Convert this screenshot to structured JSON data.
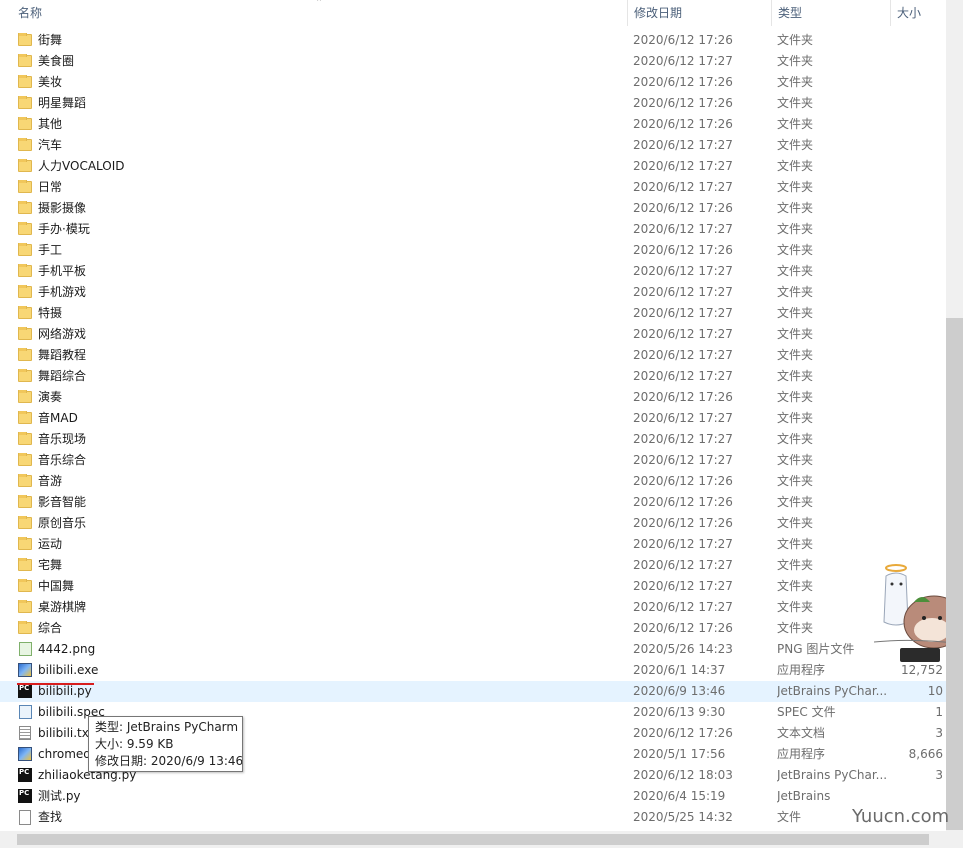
{
  "columns": {
    "name": "名称",
    "date": "修改日期",
    "type": "类型",
    "size": "大小"
  },
  "rows": [
    {
      "name": "街舞",
      "date": "2020/6/12 17:26",
      "type": "文件夹",
      "size": "",
      "icon": "folder"
    },
    {
      "name": "美食圈",
      "date": "2020/6/12 17:27",
      "type": "文件夹",
      "size": "",
      "icon": "folder"
    },
    {
      "name": "美妆",
      "date": "2020/6/12 17:26",
      "type": "文件夹",
      "size": "",
      "icon": "folder"
    },
    {
      "name": "明星舞蹈",
      "date": "2020/6/12 17:26",
      "type": "文件夹",
      "size": "",
      "icon": "folder"
    },
    {
      "name": "其他",
      "date": "2020/6/12 17:26",
      "type": "文件夹",
      "size": "",
      "icon": "folder"
    },
    {
      "name": "汽车",
      "date": "2020/6/12 17:27",
      "type": "文件夹",
      "size": "",
      "icon": "folder"
    },
    {
      "name": "人力VOCALOID",
      "date": "2020/6/12 17:27",
      "type": "文件夹",
      "size": "",
      "icon": "folder"
    },
    {
      "name": "日常",
      "date": "2020/6/12 17:27",
      "type": "文件夹",
      "size": "",
      "icon": "folder"
    },
    {
      "name": "摄影摄像",
      "date": "2020/6/12 17:26",
      "type": "文件夹",
      "size": "",
      "icon": "folder"
    },
    {
      "name": "手办·模玩",
      "date": "2020/6/12 17:27",
      "type": "文件夹",
      "size": "",
      "icon": "folder"
    },
    {
      "name": "手工",
      "date": "2020/6/12 17:26",
      "type": "文件夹",
      "size": "",
      "icon": "folder"
    },
    {
      "name": "手机平板",
      "date": "2020/6/12 17:27",
      "type": "文件夹",
      "size": "",
      "icon": "folder"
    },
    {
      "name": "手机游戏",
      "date": "2020/6/12 17:27",
      "type": "文件夹",
      "size": "",
      "icon": "folder"
    },
    {
      "name": "特摄",
      "date": "2020/6/12 17:27",
      "type": "文件夹",
      "size": "",
      "icon": "folder"
    },
    {
      "name": "网络游戏",
      "date": "2020/6/12 17:27",
      "type": "文件夹",
      "size": "",
      "icon": "folder"
    },
    {
      "name": "舞蹈教程",
      "date": "2020/6/12 17:27",
      "type": "文件夹",
      "size": "",
      "icon": "folder"
    },
    {
      "name": "舞蹈综合",
      "date": "2020/6/12 17:27",
      "type": "文件夹",
      "size": "",
      "icon": "folder"
    },
    {
      "name": "演奏",
      "date": "2020/6/12 17:26",
      "type": "文件夹",
      "size": "",
      "icon": "folder"
    },
    {
      "name": "音MAD",
      "date": "2020/6/12 17:27",
      "type": "文件夹",
      "size": "",
      "icon": "folder"
    },
    {
      "name": "音乐现场",
      "date": "2020/6/12 17:27",
      "type": "文件夹",
      "size": "",
      "icon": "folder"
    },
    {
      "name": "音乐综合",
      "date": "2020/6/12 17:27",
      "type": "文件夹",
      "size": "",
      "icon": "folder"
    },
    {
      "name": "音游",
      "date": "2020/6/12 17:26",
      "type": "文件夹",
      "size": "",
      "icon": "folder"
    },
    {
      "name": "影音智能",
      "date": "2020/6/12 17:26",
      "type": "文件夹",
      "size": "",
      "icon": "folder"
    },
    {
      "name": "原创音乐",
      "date": "2020/6/12 17:26",
      "type": "文件夹",
      "size": "",
      "icon": "folder"
    },
    {
      "name": "运动",
      "date": "2020/6/12 17:27",
      "type": "文件夹",
      "size": "",
      "icon": "folder"
    },
    {
      "name": "宅舞",
      "date": "2020/6/12 17:27",
      "type": "文件夹",
      "size": "",
      "icon": "folder"
    },
    {
      "name": "中国舞",
      "date": "2020/6/12 17:27",
      "type": "文件夹",
      "size": "",
      "icon": "folder"
    },
    {
      "name": "桌游棋牌",
      "date": "2020/6/12 17:27",
      "type": "文件夹",
      "size": "",
      "icon": "folder"
    },
    {
      "name": "综合",
      "date": "2020/6/12 17:26",
      "type": "文件夹",
      "size": "",
      "icon": "folder"
    },
    {
      "name": "4442.png",
      "date": "2020/5/26 14:23",
      "type": "PNG 图片文件",
      "size": "",
      "icon": "png"
    },
    {
      "name": "bilibili.exe",
      "date": "2020/6/1 14:37",
      "type": "应用程序",
      "size": "12,752",
      "icon": "exe"
    },
    {
      "name": "bilibili.py",
      "date": "2020/6/9 13:46",
      "type": "JetBrains PyChar...",
      "size": "10",
      "icon": "pycharm",
      "selected": true
    },
    {
      "name": "bilibili.spec",
      "date": "2020/6/13 9:30",
      "type": "SPEC 文件",
      "size": "1",
      "icon": "spec"
    },
    {
      "name": "bilibili.txt",
      "date": "2020/6/12 17:26",
      "type": "文本文档",
      "size": "3",
      "icon": "txt"
    },
    {
      "name": "chromed",
      "date": "2020/5/1 17:56",
      "type": "应用程序",
      "size": "8,666",
      "icon": "exe"
    },
    {
      "name": "zhiliaoketang.py",
      "date": "2020/6/12 18:03",
      "type": "JetBrains PyChar...",
      "size": "3",
      "icon": "pycharm"
    },
    {
      "name": "测试.py",
      "date": "2020/6/4 15:19",
      "type": "JetBrains",
      "size": "",
      "icon": "pycharm"
    },
    {
      "name": "查找",
      "date": "2020/5/25 14:32",
      "type": "文件",
      "size": "",
      "icon": "blank"
    }
  ],
  "tooltip": {
    "line1": "类型: JetBrains PyCharm",
    "line2": "大小: 9.59 KB",
    "line3": "修改日期: 2020/6/9 13:46"
  },
  "watermark": "Yuucn.com"
}
